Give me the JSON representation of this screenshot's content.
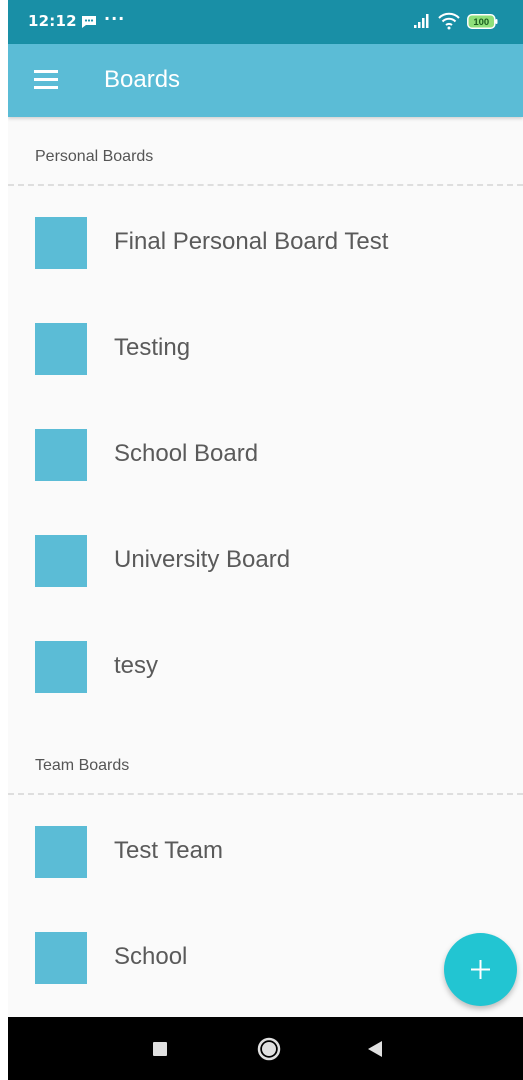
{
  "status_bar": {
    "time": "12:12",
    "dots": "···",
    "battery": "100",
    "background_color": "#198fa6",
    "icons": [
      "message-icon",
      "signal-icon",
      "wifi-icon",
      "battery-icon"
    ]
  },
  "app_bar": {
    "title": "Boards",
    "menu_icon": "hamburger-menu-icon",
    "background_color": "#5bbcd6"
  },
  "personal_section": {
    "header": "Personal Boards",
    "boards": [
      {
        "name": "Final Personal Board Test",
        "color": "#5bbcd6"
      },
      {
        "name": "Testing",
        "color": "#5bbcd6"
      },
      {
        "name": "School Board",
        "color": "#5bbcd6"
      },
      {
        "name": "University Board",
        "color": "#5bbcd6"
      },
      {
        "name": "tesy",
        "color": "#5bbcd6"
      }
    ]
  },
  "team_section": {
    "header": "Team Boards",
    "boards": [
      {
        "name": "Test Team",
        "color": "#5bbcd6"
      },
      {
        "name": "School",
        "color": "#5bbcd6"
      }
    ]
  },
  "fab": {
    "icon": "plus-icon",
    "color": "#22c5d2"
  },
  "nav_bar": {
    "icons": [
      "recents-square-icon",
      "home-circle-icon",
      "back-triangle-icon"
    ]
  }
}
